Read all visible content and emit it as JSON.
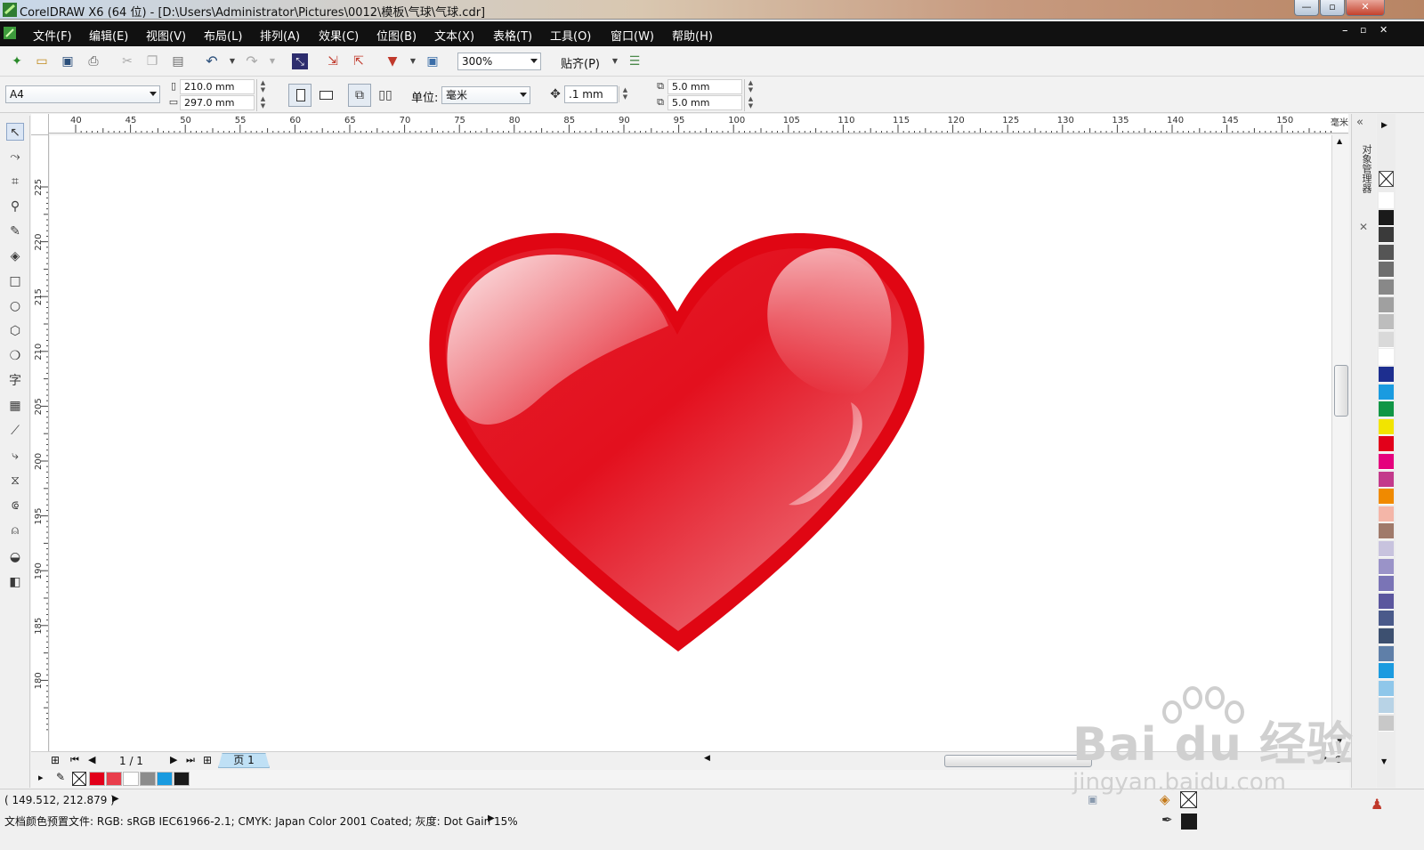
{
  "window": {
    "title": "CorelDRAW X6 (64 位) - [D:\\Users\\Administrator\\Pictures\\0012\\模板\\气球\\气球.cdr]",
    "controls": [
      "—",
      "▫",
      "✕"
    ]
  },
  "menu": {
    "items": [
      "文件(F)",
      "编辑(E)",
      "视图(V)",
      "布局(L)",
      "排列(A)",
      "效果(C)",
      "位图(B)",
      "文本(X)",
      "表格(T)",
      "工具(O)",
      "窗口(W)",
      "帮助(H)"
    ]
  },
  "toolbar": {
    "zoom": "300%",
    "snap_label": "贴齐(P)"
  },
  "properties": {
    "page_size": "A4",
    "width": "210.0 mm",
    "height": "297.0 mm",
    "units_label": "单位:",
    "units_value": "毫米",
    "nudge": ".1 mm",
    "dup_x": "5.0 mm",
    "dup_y": "5.0 mm"
  },
  "rulers": {
    "h_ticks": [
      "40",
      "45",
      "50",
      "55",
      "60",
      "65",
      "70",
      "75",
      "80",
      "85",
      "90",
      "95",
      "100",
      "105",
      "110",
      "115",
      "120",
      "125",
      "130",
      "135",
      "140",
      "145",
      "150"
    ],
    "h_unit": "毫米",
    "v_ticks": [
      "225",
      "220",
      "215",
      "210",
      "205",
      "200",
      "195",
      "190",
      "185",
      "180"
    ]
  },
  "dock": {
    "label": "对象管理器"
  },
  "pagebar": {
    "page_count": "1 / 1",
    "page_tab": "页 1"
  },
  "status": {
    "coordinates": "( 149.512, 212.879 )",
    "color_profile": "文档颜色预置文件: RGB: sRGB IEC61966-2.1; CMYK: Japan Color 2001 Coated; 灰度: Dot Gain 15%"
  },
  "watermark": {
    "brand": "Bai du 经验",
    "url": "jingyan.baidu.com"
  },
  "colors": {
    "heart_outline": "#e00613",
    "heart_fill": "#e4202c",
    "palette": [
      "#ffffff",
      "#1a1a1a",
      "#3a3a3a",
      "#555555",
      "#6e6e6e",
      "#888888",
      "#a0a0a0",
      "#bdbdbd",
      "#d9d9d9",
      "#ffffff",
      "#1d2e8f",
      "#1a9be0",
      "#109646",
      "#f2e400",
      "#e2001a",
      "#e5007d",
      "#c33a8c",
      "#f08a00",
      "#f4b6a8",
      "#a07a6b",
      "#c8c3de",
      "#9a93c8",
      "#7a74b6",
      "#5b569e",
      "#4a5a8a",
      "#3d5070",
      "#5f7fa8",
      "#1b9be0",
      "#8fc7ea",
      "#b8d3e6",
      "#c8c8c8"
    ],
    "doc_palette": [
      "#e2001a",
      "#e93e4c",
      "#ffffff",
      "#8c8c8c",
      "#1a9be0",
      "#1a1a1a"
    ]
  }
}
